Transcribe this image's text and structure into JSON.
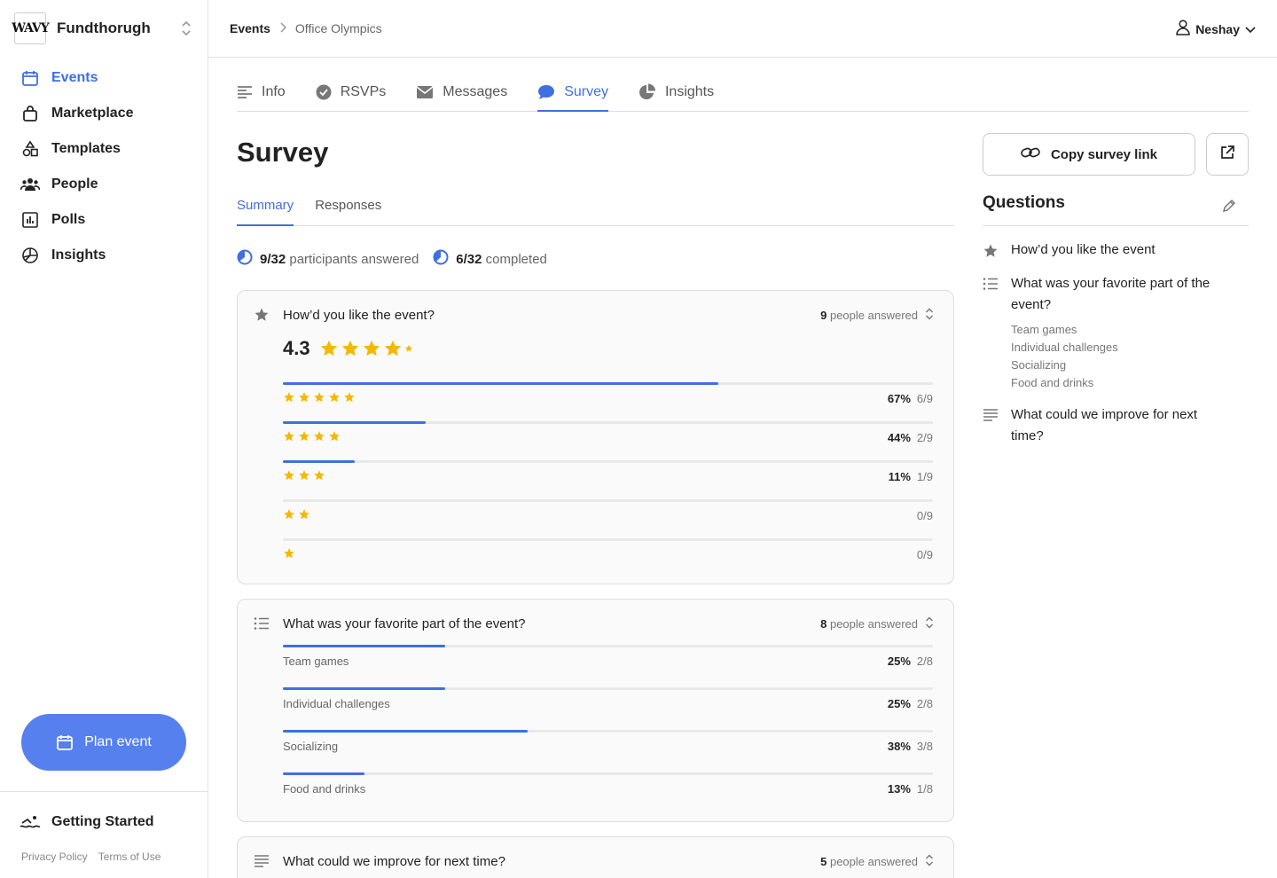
{
  "org": {
    "logo_text": "WAVY",
    "name": "Fundthorugh"
  },
  "nav": [
    {
      "label": "Events",
      "icon": "calendar-icon",
      "active": true
    },
    {
      "label": "Marketplace",
      "icon": "bag-icon"
    },
    {
      "label": "Templates",
      "icon": "shapes-icon"
    },
    {
      "label": "People",
      "icon": "people-icon"
    },
    {
      "label": "Polls",
      "icon": "poll-icon"
    },
    {
      "label": "Insights",
      "icon": "pie-icon"
    }
  ],
  "plan_event": "Plan event",
  "getting_started": "Getting Started",
  "legal": {
    "privacy": "Privacy Policy",
    "terms": "Terms of Use"
  },
  "breadcrumb": {
    "root": "Events",
    "current": "Office Olympics"
  },
  "user": {
    "name": "Neshay"
  },
  "tabs": [
    {
      "label": "Info",
      "icon": "lines-icon"
    },
    {
      "label": "RSVPs",
      "icon": "check-circle-icon"
    },
    {
      "label": "Messages",
      "icon": "envelope-icon"
    },
    {
      "label": "Survey",
      "icon": "chat-bubble-icon",
      "active": true
    },
    {
      "label": "Insights",
      "icon": "pie-icon"
    }
  ],
  "page_title": "Survey",
  "subtabs": {
    "summary": "Summary",
    "responses": "Responses"
  },
  "stats": {
    "answered_count": "9/32",
    "answered_label": "participants answered",
    "completed_count": "6/32",
    "completed_label": "completed"
  },
  "q1": {
    "title": "How’d you like the event?",
    "answered_count": "9",
    "answered_label": "people answered",
    "rating": "4.3",
    "rows": [
      {
        "stars": 5,
        "fill": 0.67,
        "pct": "67%",
        "count": "6/9"
      },
      {
        "stars": 4,
        "fill": 0.22,
        "pct": "44%",
        "count": "2/9"
      },
      {
        "stars": 3,
        "fill": 0.11,
        "pct": "11%",
        "count": "1/9"
      },
      {
        "stars": 2,
        "fill": 0,
        "pct": "",
        "count": "0/9"
      },
      {
        "stars": 1,
        "fill": 0,
        "pct": "",
        "count": "0/9"
      }
    ]
  },
  "q2": {
    "title": "What was your favorite part of the event?",
    "answered_count": "8",
    "answered_label": "people answered",
    "rows": [
      {
        "label": "Team games",
        "fill": 0.25,
        "pct": "25%",
        "count": "2/8"
      },
      {
        "label": "Individual challenges",
        "fill": 0.25,
        "pct": "25%",
        "count": "2/8"
      },
      {
        "label": "Socializing",
        "fill": 0.376,
        "pct": "38%",
        "count": "3/8"
      },
      {
        "label": "Food and drinks",
        "fill": 0.126,
        "pct": "13%",
        "count": "1/8"
      }
    ]
  },
  "q3": {
    "title": "What could we improve for next time?",
    "answered_count": "5",
    "answered_label": "people answered"
  },
  "right": {
    "copy_link": "Copy survey link",
    "questions_title": "Questions",
    "questions": [
      {
        "icon": "star-icon",
        "text": "How’d you like the event"
      },
      {
        "icon": "list-icon",
        "text": "What was your favorite part of the event?",
        "options": [
          "Team games",
          "Individual challenges",
          "Socializing",
          "Food and drinks"
        ]
      },
      {
        "icon": "text-lines-icon",
        "text": "What could we improve for next time?"
      }
    ]
  },
  "colors": {
    "accent": "#3f6fe0",
    "button": "#5680ee",
    "star": "#f5b800"
  }
}
